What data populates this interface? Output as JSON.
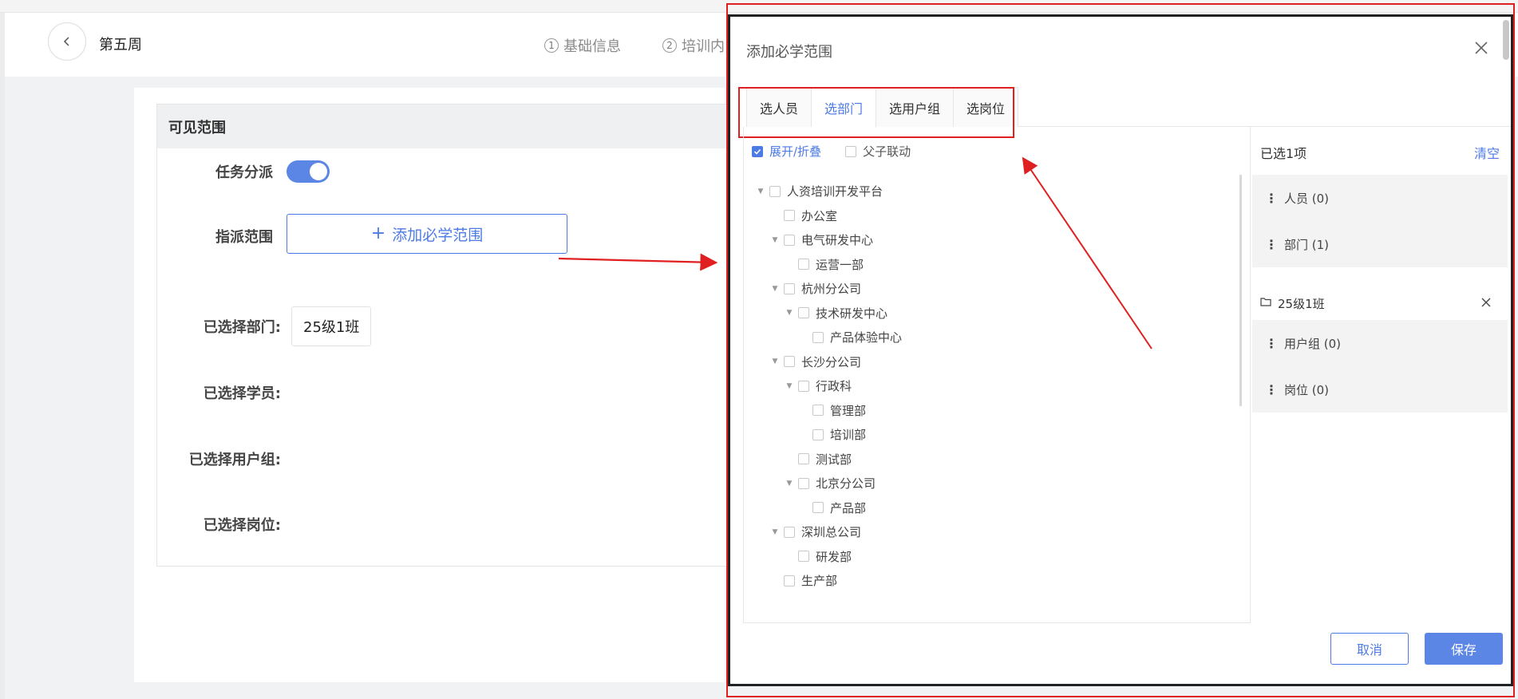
{
  "header": {
    "title": "第五周",
    "steps": [
      {
        "num": "1",
        "label": "基础信息"
      },
      {
        "num": "2",
        "label": "培训内"
      }
    ]
  },
  "section": {
    "title": "可见范围",
    "task_assign_label": "任务分派",
    "task_assign_enabled": true,
    "assign_scope_label": "指派范围",
    "add_scope_button": "添加必学范围",
    "selected_dept_label": "已选择部门:",
    "selected_dept_value": "25级1班",
    "selected_student_label": "已选择学员:",
    "selected_group_label": "已选择用户组:",
    "selected_post_label": "已选择岗位:"
  },
  "dialog": {
    "title": "添加必学范围",
    "tabs": [
      "选人员",
      "选部门",
      "选用户组",
      "选岗位"
    ],
    "active_tab": 1,
    "expand_collapse": "展开/折叠",
    "expand_collapse_checked": true,
    "parent_child_link": "父子联动",
    "tree": [
      {
        "label": "人资培训开发平台",
        "level": 0,
        "caret": true
      },
      {
        "label": "办公室",
        "level": 1,
        "caret": false
      },
      {
        "label": "电气研发中心",
        "level": 1,
        "caret": true
      },
      {
        "label": "运营一部",
        "level": 2,
        "caret": false
      },
      {
        "label": "杭州分公司",
        "level": 1,
        "caret": true
      },
      {
        "label": "技术研发中心",
        "level": 2,
        "caret": true
      },
      {
        "label": "产品体验中心",
        "level": 3,
        "caret": false
      },
      {
        "label": "长沙分公司",
        "level": 1,
        "caret": true
      },
      {
        "label": "行政科",
        "level": 2,
        "caret": true
      },
      {
        "label": "管理部",
        "level": 3,
        "caret": false
      },
      {
        "label": "培训部",
        "level": 3,
        "caret": false
      },
      {
        "label": "测试部",
        "level": 2,
        "caret": false
      },
      {
        "label": "北京分公司",
        "level": 2,
        "caret": true
      },
      {
        "label": "产品部",
        "level": 3,
        "caret": false
      },
      {
        "label": "深圳总公司",
        "level": 1,
        "caret": true
      },
      {
        "label": "研发部",
        "level": 2,
        "caret": false
      },
      {
        "label": "生产部",
        "level": 1,
        "caret": false
      }
    ],
    "selected_count": "已选1项",
    "clear": "清空",
    "groups_top": [
      "人员 (0)",
      "部门 (1)"
    ],
    "chosen_item": "25级1班",
    "groups_bottom": [
      "用户组 (0)",
      "岗位 (0)"
    ],
    "cancel": "取消",
    "save": "保存"
  },
  "colors": {
    "accent": "#4d7be6",
    "annotation": "#e02020"
  }
}
